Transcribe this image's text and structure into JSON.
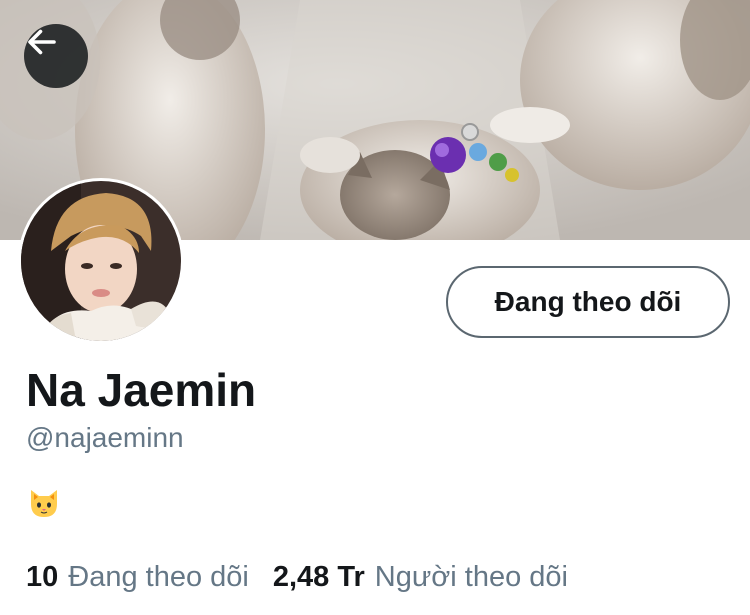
{
  "profile": {
    "display_name": "Na Jaemin",
    "handle": "@najaeminn",
    "bio_emoji": "cat-face-emoji",
    "follow_button_label": "Đang theo dõi"
  },
  "stats": {
    "following_count": "10",
    "following_label": "Đang theo dõi",
    "followers_count": "2,48 Tr",
    "followers_label": "Người theo dõi"
  },
  "icons": {
    "back": "arrow-left-icon",
    "bio": "cat-face-emoji"
  },
  "colors": {
    "text_primary": "#14171a",
    "text_secondary": "#657786",
    "button_border": "#5b6770",
    "back_button_bg": "#14171a"
  }
}
